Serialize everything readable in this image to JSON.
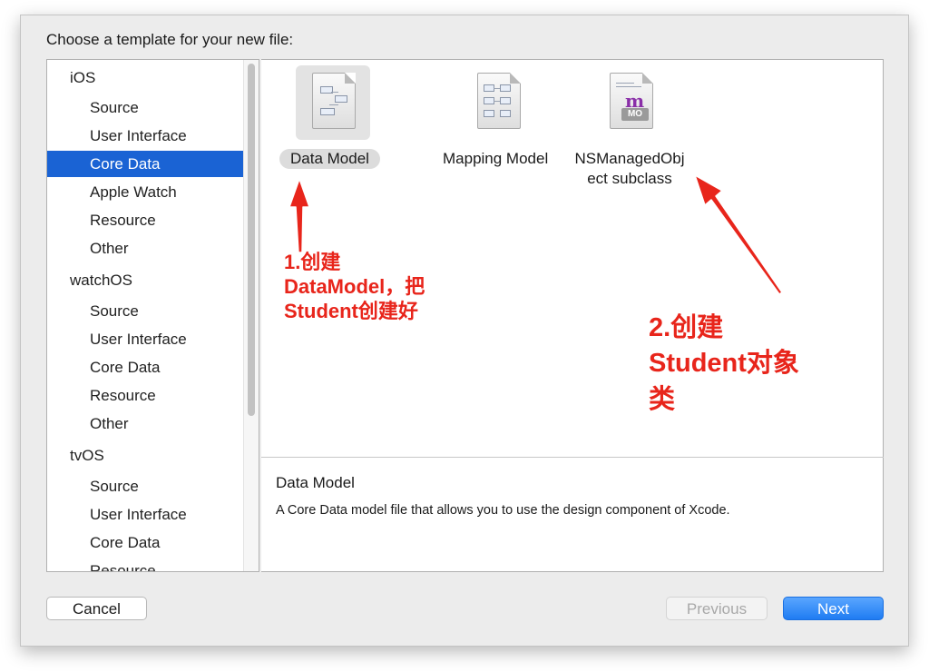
{
  "dialog": {
    "prompt": "Choose a template for your new file:"
  },
  "sidebar": {
    "items": [
      {
        "label": "iOS",
        "level": "category"
      },
      {
        "label": "Source",
        "level": "item"
      },
      {
        "label": "User Interface",
        "level": "item"
      },
      {
        "label": "Core Data",
        "level": "item",
        "selected": true
      },
      {
        "label": "Apple Watch",
        "level": "item"
      },
      {
        "label": "Resource",
        "level": "item"
      },
      {
        "label": "Other",
        "level": "item"
      },
      {
        "label": "watchOS",
        "level": "category"
      },
      {
        "label": "Source",
        "level": "item"
      },
      {
        "label": "User Interface",
        "level": "item"
      },
      {
        "label": "Core Data",
        "level": "item"
      },
      {
        "label": "Resource",
        "level": "item"
      },
      {
        "label": "Other",
        "level": "item"
      },
      {
        "label": "tvOS",
        "level": "category"
      },
      {
        "label": "Source",
        "level": "item"
      },
      {
        "label": "User Interface",
        "level": "item"
      },
      {
        "label": "Core Data",
        "level": "item"
      },
      {
        "label": "Resource",
        "level": "item"
      }
    ]
  },
  "templates": [
    {
      "label": "Data Model",
      "icon": "data-model-icon",
      "selected": true
    },
    {
      "label": "Mapping Model",
      "icon": "mapping-model-icon",
      "selected": false
    },
    {
      "label_line1": "NSManagedObj",
      "label_line2": "ect subclass",
      "icon": "managed-object-icon",
      "icon_badge": "MO",
      "icon_glyph": "m",
      "selected": false
    }
  ],
  "description": {
    "title": "Data Model",
    "text": "A Core Data model file that allows you to use the design component of Xcode."
  },
  "buttons": {
    "cancel": "Cancel",
    "previous": "Previous",
    "next": "Next"
  },
  "annotations": {
    "first": [
      "1.创建",
      "DataModel，把",
      "Student创建好"
    ],
    "second": [
      "2.创建",
      "Student对象",
      "类"
    ],
    "color": "#e8251b"
  },
  "colors": {
    "selection": "#1a63d4",
    "accent": "#1f7cf2"
  }
}
